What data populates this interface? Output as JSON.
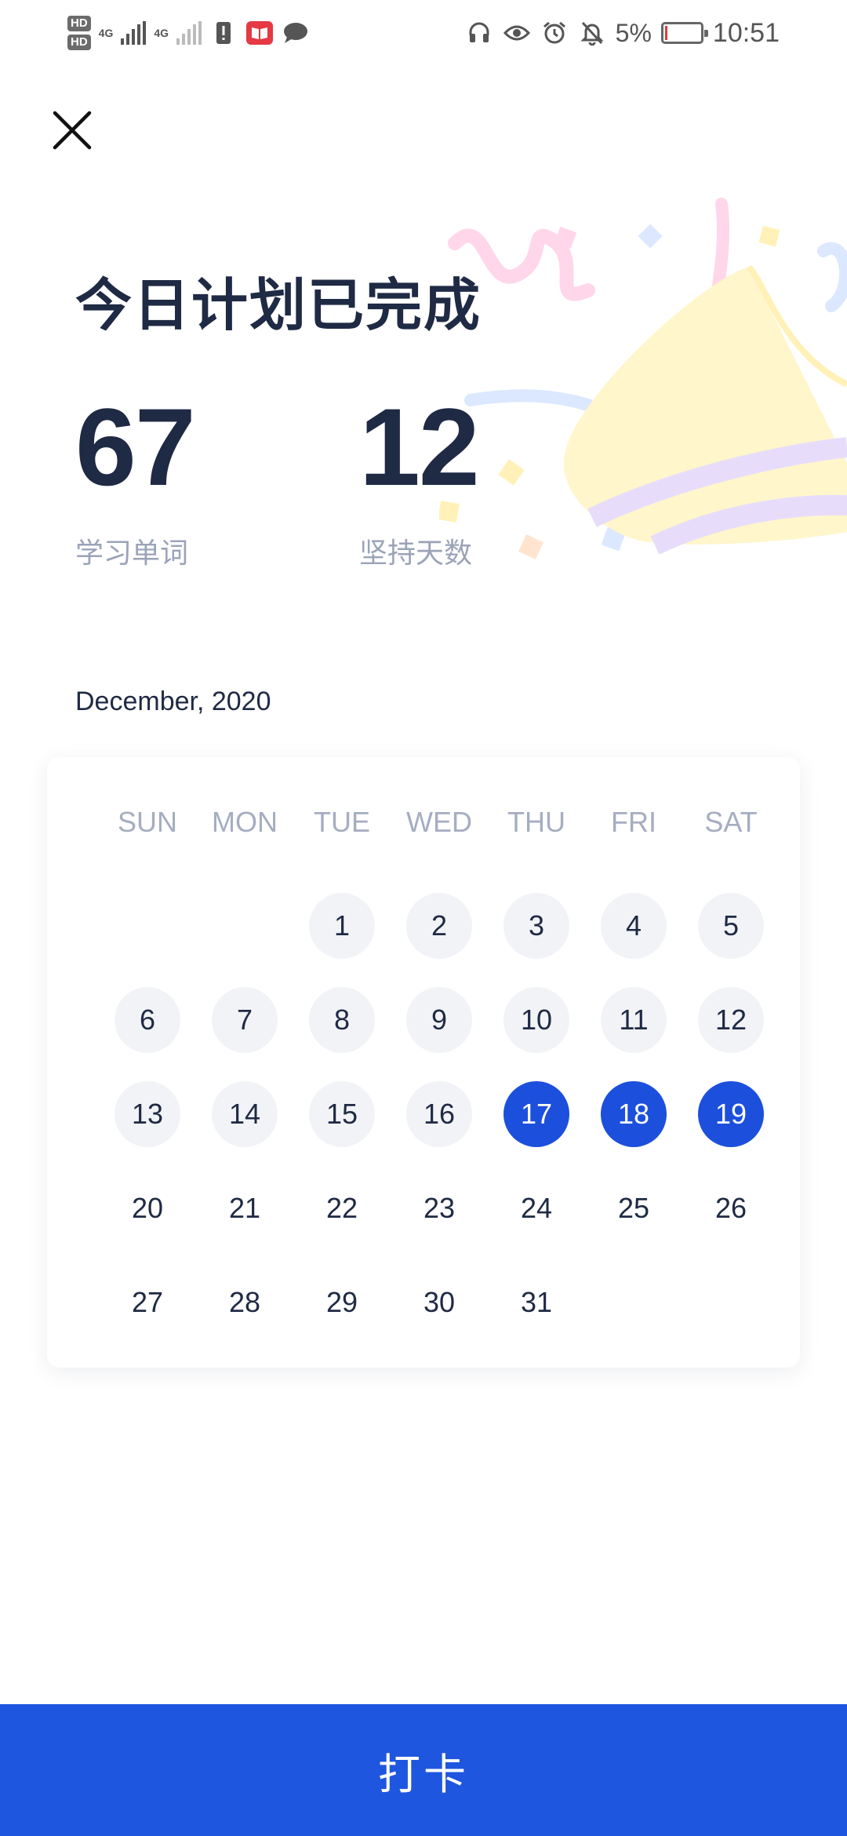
{
  "status_bar": {
    "hd1": "HD",
    "hd2": "HD",
    "net1": "4G",
    "net2": "4G",
    "battery_percent": "5%",
    "time": "10:51",
    "icons": [
      "warning-icon",
      "book-app-icon",
      "chat-icon",
      "headset-icon",
      "eye-icon",
      "alarm-icon",
      "mute-bell-icon",
      "battery-icon"
    ]
  },
  "page": {
    "title": "今日计划已完成",
    "stats": [
      {
        "value": "67",
        "label": "学习单词"
      },
      {
        "value": "12",
        "label": "坚持天数"
      }
    ],
    "month_label": "December, 2020"
  },
  "calendar": {
    "weekdays": [
      "SUN",
      "MON",
      "TUE",
      "WED",
      "THU",
      "FRI",
      "SAT"
    ],
    "leading_blanks": 2,
    "days": [
      {
        "d": "1",
        "state": "learned"
      },
      {
        "d": "2",
        "state": "learned"
      },
      {
        "d": "3",
        "state": "learned"
      },
      {
        "d": "4",
        "state": "learned"
      },
      {
        "d": "5",
        "state": "learned"
      },
      {
        "d": "6",
        "state": "learned"
      },
      {
        "d": "7",
        "state": "learned"
      },
      {
        "d": "8",
        "state": "learned"
      },
      {
        "d": "9",
        "state": "learned"
      },
      {
        "d": "10",
        "state": "learned"
      },
      {
        "d": "11",
        "state": "learned"
      },
      {
        "d": "12",
        "state": "learned"
      },
      {
        "d": "13",
        "state": "learned"
      },
      {
        "d": "14",
        "state": "learned"
      },
      {
        "d": "15",
        "state": "learned"
      },
      {
        "d": "16",
        "state": "learned"
      },
      {
        "d": "17",
        "state": "checked"
      },
      {
        "d": "18",
        "state": "checked"
      },
      {
        "d": "19",
        "state": "checked"
      },
      {
        "d": "20",
        "state": "none"
      },
      {
        "d": "21",
        "state": "none"
      },
      {
        "d": "22",
        "state": "none"
      },
      {
        "d": "23",
        "state": "none"
      },
      {
        "d": "24",
        "state": "none"
      },
      {
        "d": "25",
        "state": "none"
      },
      {
        "d": "26",
        "state": "none"
      },
      {
        "d": "27",
        "state": "none"
      },
      {
        "d": "28",
        "state": "none"
      },
      {
        "d": "29",
        "state": "none"
      },
      {
        "d": "30",
        "state": "none"
      },
      {
        "d": "31",
        "state": "none"
      }
    ]
  },
  "actions": {
    "close_icon": "close-icon",
    "checkin_label": "打卡"
  },
  "colors": {
    "accent": "#1f56e0",
    "checked_day": "#1c4fdc",
    "learned_day": "#f1f3f7",
    "title_text": "#1f2a44",
    "muted_text": "#9aa3b8"
  }
}
